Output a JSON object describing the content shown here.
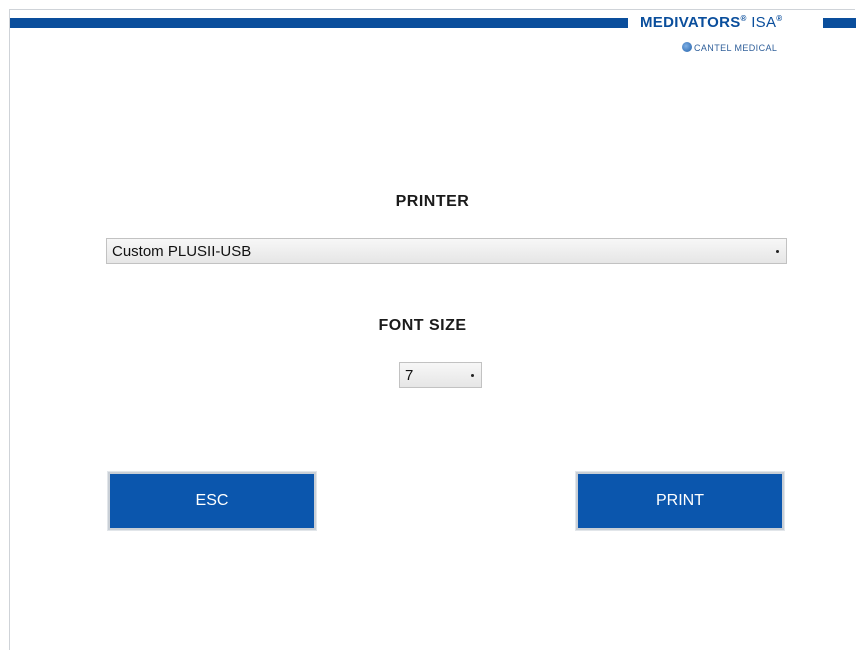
{
  "brand": {
    "name": "MEDIVATORS",
    "reg_mark": "®",
    "suffix": "ISA",
    "suffix_mark": "®",
    "sub": "CANTEL MEDICAL",
    "color": "#0a4e9c"
  },
  "printer": {
    "label": "PRINTER",
    "selected": "Custom PLUSII-USB"
  },
  "font_size": {
    "label": "FONT SIZE",
    "selected": "7"
  },
  "buttons": {
    "esc": "ESC",
    "print": "PRINT",
    "color": "#0b56ad"
  }
}
